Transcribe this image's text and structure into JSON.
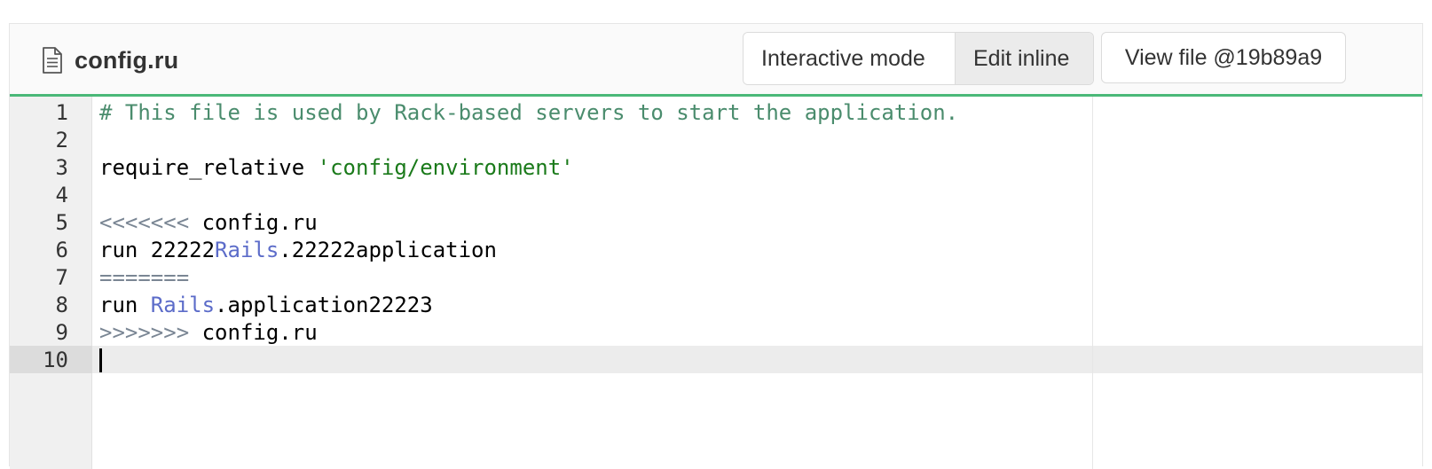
{
  "file": {
    "icon": "file-text-icon",
    "name": "config.ru"
  },
  "toolbar": {
    "interactive_mode_label": "Interactive mode",
    "edit_inline_label": "Edit inline",
    "view_file_label": "View file @19b89a9"
  },
  "editor": {
    "active_line": 10,
    "lines": [
      {
        "number": "1",
        "segments": [
          {
            "type": "comment",
            "text": "# This file is used by Rack-based servers to start the application."
          }
        ]
      },
      {
        "number": "2",
        "segments": []
      },
      {
        "number": "3",
        "segments": [
          {
            "type": "plain",
            "text": "require_relative "
          },
          {
            "type": "string",
            "text": "'config/environment'"
          }
        ]
      },
      {
        "number": "4",
        "segments": []
      },
      {
        "number": "5",
        "segments": [
          {
            "type": "marker",
            "text": "<<<<<<<"
          },
          {
            "type": "plain",
            "text": " config.ru"
          }
        ]
      },
      {
        "number": "6",
        "segments": [
          {
            "type": "plain",
            "text": "run 22222"
          },
          {
            "type": "const",
            "text": "Rails"
          },
          {
            "type": "plain",
            "text": ".22222application"
          }
        ]
      },
      {
        "number": "7",
        "segments": [
          {
            "type": "marker",
            "text": "======="
          }
        ]
      },
      {
        "number": "8",
        "segments": [
          {
            "type": "plain",
            "text": "run "
          },
          {
            "type": "const",
            "text": "Rails"
          },
          {
            "type": "plain",
            "text": ".application22223"
          }
        ]
      },
      {
        "number": "9",
        "segments": [
          {
            "type": "marker",
            "text": ">>>>>>>"
          },
          {
            "type": "plain",
            "text": " config.ru"
          }
        ]
      },
      {
        "number": "10",
        "segments": []
      }
    ]
  },
  "colors": {
    "accent_border": "#4ab878",
    "comment": "#4a8c6d",
    "string": "#1a7a1a",
    "constant": "#5c6cc9",
    "conflict_marker": "#7a8694"
  }
}
